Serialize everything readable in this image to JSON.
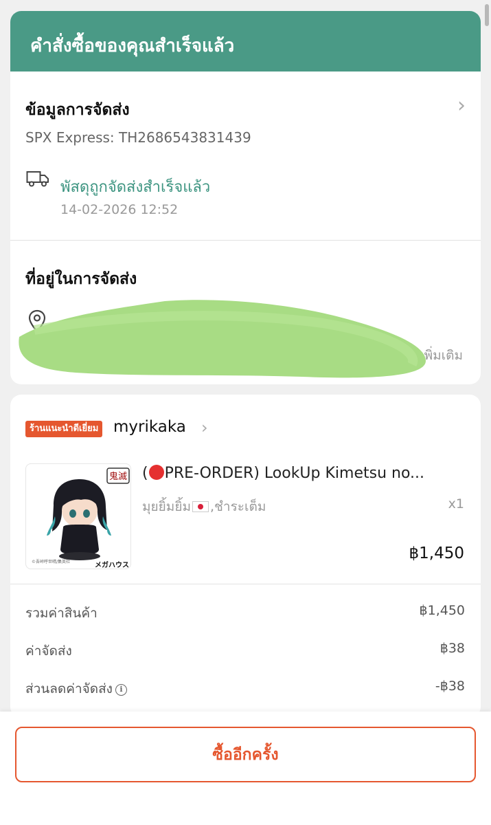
{
  "header": {
    "status_title": "คำสั่งซื้อของคุณสำเร็จแล้ว"
  },
  "shipping": {
    "title": "ข้อมูลการจัดส่ง",
    "tracking": "SPX Express: TH2686543831439",
    "status": "พัสดุถูกจัดส่งสำเร็จแล้ว",
    "timestamp": "14-02-2026 12:52",
    "icon": "truck-icon"
  },
  "address": {
    "title": "ที่อยู่ในการจัดส่ง",
    "more_label": "เพิ่มเติม",
    "icon": "location-pin-icon",
    "redaction_color": "#a8dc84"
  },
  "shop": {
    "badge": "ร้านแนะนำดีเยี่ยม",
    "name": "myrikaka"
  },
  "product": {
    "name_prefix": "(",
    "name_rest": "PRE-ORDER) LookUp Kimetsu no...",
    "variant_text": "มุยยิ้มยิ้ม",
    "variant_suffix": ",ชำระเต็ม",
    "quantity": "x1",
    "price": "฿1,450",
    "thumb_logo": "鬼滅",
    "thumb_brand": "メガハウス"
  },
  "summary": {
    "rows": [
      {
        "label": "รวมค่าสินค้า",
        "value": "฿1,450"
      },
      {
        "label": "ค่าจัดส่ง",
        "value": "฿38"
      },
      {
        "label": "ส่วนลดค่าจัดส่ง",
        "value": "-฿38"
      }
    ]
  },
  "actions": {
    "buy_again": "ซื้ออีกครั้ง"
  },
  "colors": {
    "header_bg": "#4a9a86",
    "accent": "#e5572f",
    "status_green": "#3c9480"
  }
}
